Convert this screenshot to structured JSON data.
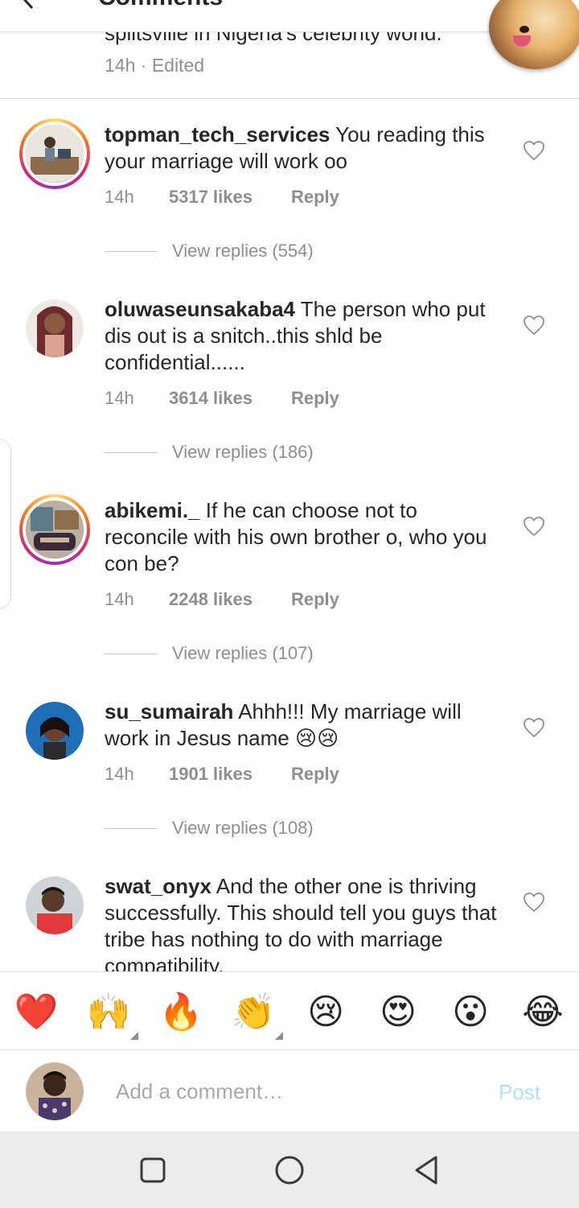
{
  "header": {
    "title": "Comments"
  },
  "caption": {
    "text_tail": "splitsville in Nigeria's celebrity world.",
    "meta": "14h · Edited"
  },
  "comments": [
    {
      "username": "topman_tech_services",
      "text": "You reading this your marriage will work oo",
      "time": "14h",
      "likes": "5317 likes",
      "reply": "Reply",
      "view_replies": "View replies (554)",
      "ring": true
    },
    {
      "username": "oluwaseunsakaba4",
      "text": "The person who put dis out is a snitch..this shld be confidential......",
      "time": "14h",
      "likes": "3614 likes",
      "reply": "Reply",
      "view_replies": "View replies (186)",
      "ring": false
    },
    {
      "username": "abikemi._",
      "text": "If he can choose not to reconcile with his own brother o, who you con be?",
      "time": "14h",
      "likes": "2248 likes",
      "reply": "Reply",
      "view_replies": "View replies (107)",
      "ring": true
    },
    {
      "username": "su_sumairah",
      "text": "Ahhh!!! My marriage will work in Jesus name 😢😢",
      "time": "14h",
      "likes": "1901 likes",
      "reply": "Reply",
      "view_replies": "View replies (108)",
      "ring": false
    },
    {
      "username": "swat_onyx",
      "text": "And the other one is thriving successfully. This should tell you guys that tribe has nothing to do with marriage compatibility.",
      "ring": false
    }
  ],
  "emoji_bar": [
    "❤️",
    "🙌",
    "🔥",
    "👏",
    "😢",
    "😍",
    "😮",
    "😂"
  ],
  "composer": {
    "placeholder": "Add a comment…",
    "post_label": "Post"
  },
  "colors": {
    "post_disabled": "#b2dffc",
    "meta_gray": "#8e8e8e",
    "heart_red": "#ed4956"
  }
}
